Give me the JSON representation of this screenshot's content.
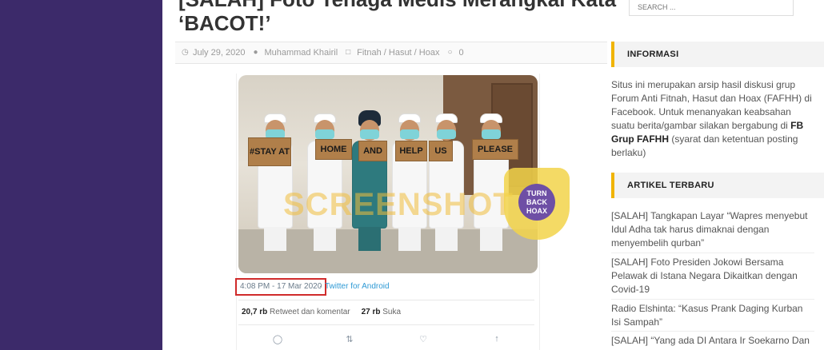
{
  "article": {
    "title": "[SALAH] Foto Tenaga Medis Merangkai Kata ‘BACOT!’",
    "date": "July 29, 2020",
    "author": "Muhammad Khairil",
    "category": "Fitnah / Hasut / Hoax",
    "comments": "0"
  },
  "tweet": {
    "signs": [
      "#STAY AT",
      "HOME",
      "AND",
      "HELP",
      "US",
      "PLEASE"
    ],
    "watermark": "SCREENSHOT BY",
    "badge_text": "TURN BACK HOAX",
    "timestamp": "4:08 PM - 17 Mar 2020",
    "separator": "·",
    "client": "Twitter for Android",
    "retweets_count": "20,7 rb",
    "retweets_label": "Retweet dan komentar",
    "likes_count": "27 rb",
    "likes_label": "Suka"
  },
  "sidebar": {
    "search_placeholder": "SEARCH ...",
    "info_heading": "INFORMASI",
    "info_text_1": "Situs ini merupakan arsip hasil diskusi grup Forum Anti Fitnah, Hasut dan Hoax (FAFHH) di Facebook. Untuk menanyakan keabsahan suatu berita/gambar silakan bergabung di ",
    "info_fb_link": "FB Grup FAFHH",
    "info_text_2": " (syarat dan ketentuan posting berlaku)",
    "recent_heading": "ARTIKEL TERBARU",
    "recent_articles": [
      "[SALAH] Tangkapan Layar “Wapres menyebut Idul Adha tak harus dimaknai dengan menyembelih qurban”",
      "[SALAH] Foto Presiden Jokowi Bersama Pelawak di Istana Negara Dikaitkan dengan Covid-19",
      "Radio Elshinta: “Kasus Prank Daging Kurban Isi Sampah”",
      "[SALAH] “Yang ada DI Antara Ir Soekarno Dan"
    ]
  },
  "colors": {
    "left_band": "#3c2a6a",
    "accent": "#f0b400",
    "highlight_box": "#d02b2b",
    "twitter_link": "#2f9ad5"
  }
}
